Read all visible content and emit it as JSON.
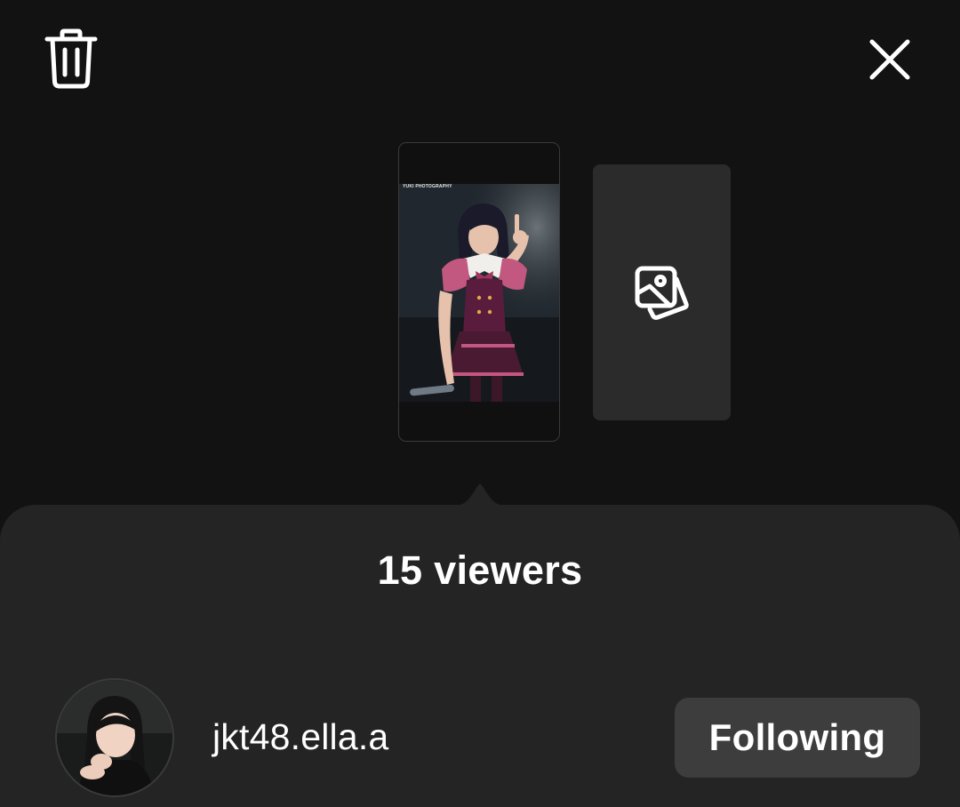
{
  "header": {
    "delete_icon": "trash-icon",
    "close_icon": "close-icon"
  },
  "stories": {
    "current": {
      "watermark": "YUKI PHOTOGRAPHY"
    },
    "add_icon": "gallery-icon"
  },
  "viewers_sheet": {
    "title": "15 viewers",
    "viewers": [
      {
        "username": "jkt48.ella.a",
        "button_label": "Following"
      }
    ]
  },
  "colors": {
    "background": "#121212",
    "sheet": "#242424",
    "button": "#3d3d3d",
    "text": "#ffffff"
  }
}
